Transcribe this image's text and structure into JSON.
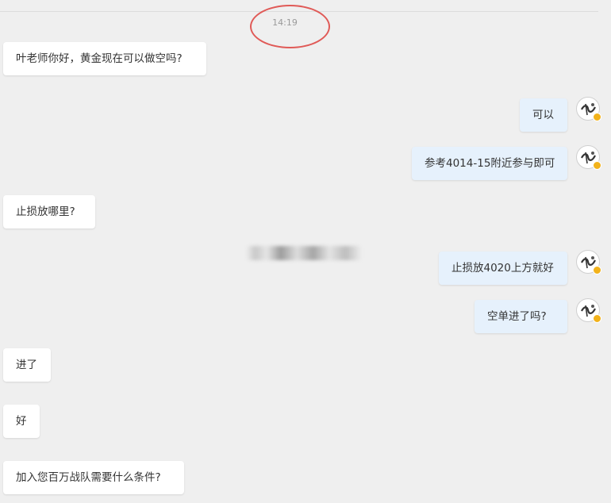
{
  "chat": {
    "timestamp": "14:19",
    "messages": [
      {
        "side": "in",
        "text": "叶老师你好，黄金现在可以做空吗?"
      },
      {
        "side": "out",
        "text": "可以"
      },
      {
        "side": "out",
        "text": "参考4014-15附近参与即可"
      },
      {
        "side": "in",
        "text": "止损放哪里?"
      },
      {
        "side": "out",
        "text": "止损放4020上方就好"
      },
      {
        "side": "out",
        "text": "空单进了吗?"
      },
      {
        "side": "in",
        "text": "进了"
      },
      {
        "side": "in",
        "text": "好"
      },
      {
        "side": "in",
        "text": "加入您百万战队需要什么条件?"
      }
    ]
  },
  "colors": {
    "background": "#efefef",
    "incoming_bubble": "#ffffff",
    "outgoing_bubble": "#e6f1fc",
    "annotation": "#e05a57",
    "verified_badge": "#f2b21a"
  },
  "icons": {
    "avatar": "teacher-avatar-icon",
    "badge": "verified-badge-icon"
  }
}
